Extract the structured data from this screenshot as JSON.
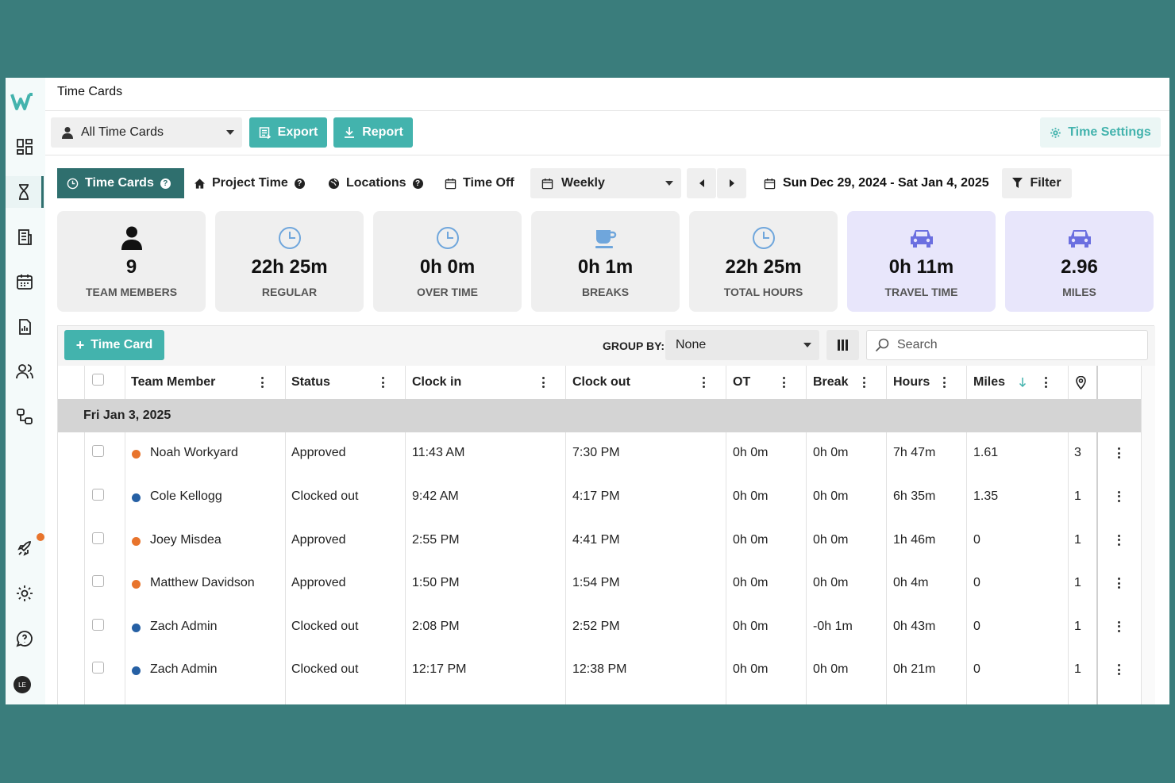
{
  "header": {
    "title": "Time Cards"
  },
  "toolbar": {
    "card_filter": "All Time Cards",
    "export_label": "Export",
    "report_label": "Report",
    "time_settings_label": "Time Settings"
  },
  "tabs": [
    {
      "label": "Time Cards",
      "help": "?"
    },
    {
      "label": "Project Time",
      "help": "?"
    },
    {
      "label": "Locations",
      "help": "?"
    },
    {
      "label": "Time Off"
    }
  ],
  "period": {
    "mode": "Weekly",
    "range": "Sun Dec 29, 2024 - Sat Jan 4, 2025",
    "filter_label": "Filter"
  },
  "stats": [
    {
      "icon": "person-icon",
      "value": "9",
      "label": "TEAM MEMBERS"
    },
    {
      "icon": "clock-icon",
      "value": "22h 25m",
      "label": "REGULAR"
    },
    {
      "icon": "clock-icon",
      "value": "0h 0m",
      "label": "OVER TIME"
    },
    {
      "icon": "coffee-icon",
      "value": "0h 1m",
      "label": "BREAKS"
    },
    {
      "icon": "clock-icon",
      "value": "22h 25m",
      "label": "TOTAL HOURS"
    },
    {
      "icon": "car-icon",
      "value": "0h 11m",
      "label": "TRAVEL TIME"
    },
    {
      "icon": "car-icon",
      "value": "2.96",
      "label": "MILES"
    }
  ],
  "table_toolbar": {
    "add_label": "Time Card",
    "group_by_label": "GROUP BY:",
    "group_by_value": "None",
    "search_placeholder": "Search"
  },
  "columns": [
    "Team Member",
    "Status",
    "Clock in",
    "Clock out",
    "OT",
    "Break",
    "Hours",
    "Miles"
  ],
  "group": {
    "label": "Fri Jan 3, 2025"
  },
  "rows": [
    {
      "member": "Noah Workyard",
      "status": "Approved",
      "clock_in": "11:43 AM",
      "clock_out": "7:30 PM",
      "ot": "0h 0m",
      "break": "0h 0m",
      "hours": "7h 47m",
      "miles": "1.61",
      "locations": "3"
    },
    {
      "member": "Cole Kellogg",
      "status": "Clocked out",
      "clock_in": "9:42 AM",
      "clock_out": "4:17 PM",
      "ot": "0h 0m",
      "break": "0h 0m",
      "hours": "6h 35m",
      "miles": "1.35",
      "locations": "1"
    },
    {
      "member": "Joey Misdea",
      "status": "Approved",
      "clock_in": "2:55 PM",
      "clock_out": "4:41 PM",
      "ot": "0h 0m",
      "break": "0h 0m",
      "hours": "1h 46m",
      "miles": "0",
      "locations": "1"
    },
    {
      "member": "Matthew Davidson",
      "status": "Approved",
      "clock_in": "1:50 PM",
      "clock_out": "1:54 PM",
      "ot": "0h 0m",
      "break": "0h 0m",
      "hours": "0h 4m",
      "miles": "0",
      "locations": "1"
    },
    {
      "member": "Zach Admin",
      "status": "Clocked out",
      "clock_in": "2:08 PM",
      "clock_out": "2:52 PM",
      "ot": "0h 0m",
      "break": "-0h 1m",
      "hours": "0h 43m",
      "miles": "0",
      "locations": "1"
    },
    {
      "member": "Zach Admin",
      "status": "Clocked out",
      "clock_in": "12:17 PM",
      "clock_out": "12:38 PM",
      "ot": "0h 0m",
      "break": "0h 0m",
      "hours": "0h 21m",
      "miles": "0",
      "locations": "1"
    }
  ],
  "user": {
    "initials": "LE"
  },
  "colors": {
    "teal": "#43b3ad",
    "dark_teal": "#2f6f6e",
    "status_approved": "#e8742c",
    "status_clocked_out": "#2660a4",
    "frame_bg": "#3a7d7c"
  }
}
